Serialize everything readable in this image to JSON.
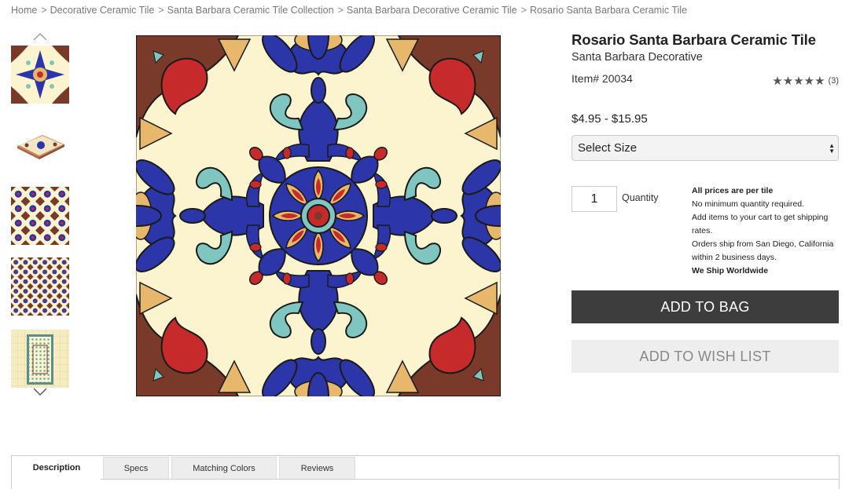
{
  "breadcrumb": [
    {
      "label": "Home"
    },
    {
      "label": "Decorative Ceramic Tile"
    },
    {
      "label": "Santa Barbara Ceramic Tile Collection"
    },
    {
      "label": "Santa Barbara Decorative Ceramic Tile"
    },
    {
      "label": "Rosario Santa Barbara Ceramic Tile"
    }
  ],
  "breadcrumb_separator": ">",
  "product": {
    "title": "Rosario Santa Barbara Ceramic Tile",
    "subtitle": "Santa Barbara Decorative",
    "item_number": "Item# 20034",
    "rating": {
      "stars": 5,
      "stars_text": "★★★★★",
      "count": "(3)"
    },
    "price": "$4.95 - $15.95",
    "size_select": {
      "value": "Select Size"
    },
    "quantity": {
      "value": "1",
      "label": "Quantity"
    },
    "info": {
      "heading": "All prices are per tile",
      "lines": [
        "No minimum quantity required.",
        "Add items to your cart to get shipping rates.",
        "Orders ship from San Diego, California within 2 business days."
      ],
      "footer": "We Ship Worldwide"
    }
  },
  "buttons": {
    "add_to_bag": "ADD TO BAG",
    "add_to_wish_list": "ADD TO WISH LIST"
  },
  "tabs": [
    {
      "label": "Description",
      "active": true
    },
    {
      "label": "Specs",
      "active": false
    },
    {
      "label": "Matching Colors",
      "active": false
    },
    {
      "label": "Reviews",
      "active": false
    }
  ],
  "colors": {
    "tile_cream": "#fbf4cf",
    "tile_brown": "#7a3a2a",
    "tile_blue": "#2c36a8",
    "tile_red": "#c62a2a",
    "tile_teal": "#7fc6c0",
    "tile_tan": "#e7b86b",
    "button_dark": "#3d3d3d",
    "button_light": "#eeeeee"
  },
  "icons": {
    "thumb_up": "chevron-up-icon",
    "thumb_down": "chevron-down-icon",
    "rating": "star-icon",
    "select": "select-caret-icon"
  }
}
